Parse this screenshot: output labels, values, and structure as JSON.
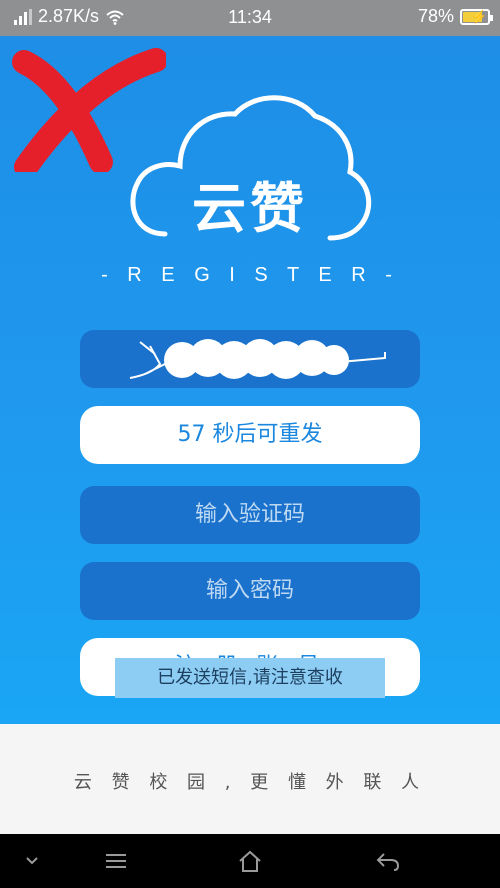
{
  "status_bar": {
    "network_speed": "2.87K/s",
    "time": "11:34",
    "battery": "78%",
    "battery_level": 0.78,
    "icons": [
      "signal-icon",
      "wifi-icon",
      "battery-icon"
    ]
  },
  "logo": {
    "title": "云赞",
    "subtitle": "- R E G I S T E R -"
  },
  "form": {
    "phone_value_redacted": true,
    "resend_label": "57 秒后可重发",
    "code_placeholder": "输入验证码",
    "password_placeholder": "输入密码",
    "register_label": "注 册 账 号"
  },
  "toast": {
    "message": "已发送短信,请注意查收"
  },
  "footer": {
    "text": "云 赞 校 园 , 更 懂 外 联 人"
  },
  "nav_bar": {
    "icons": [
      "chevron-down-icon",
      "menu-icon",
      "home-icon",
      "back-icon"
    ]
  },
  "colors": {
    "primary_blue": "#1e8ee6",
    "field_blue": "#1a72cc",
    "annotation_red": "#e5202a"
  }
}
